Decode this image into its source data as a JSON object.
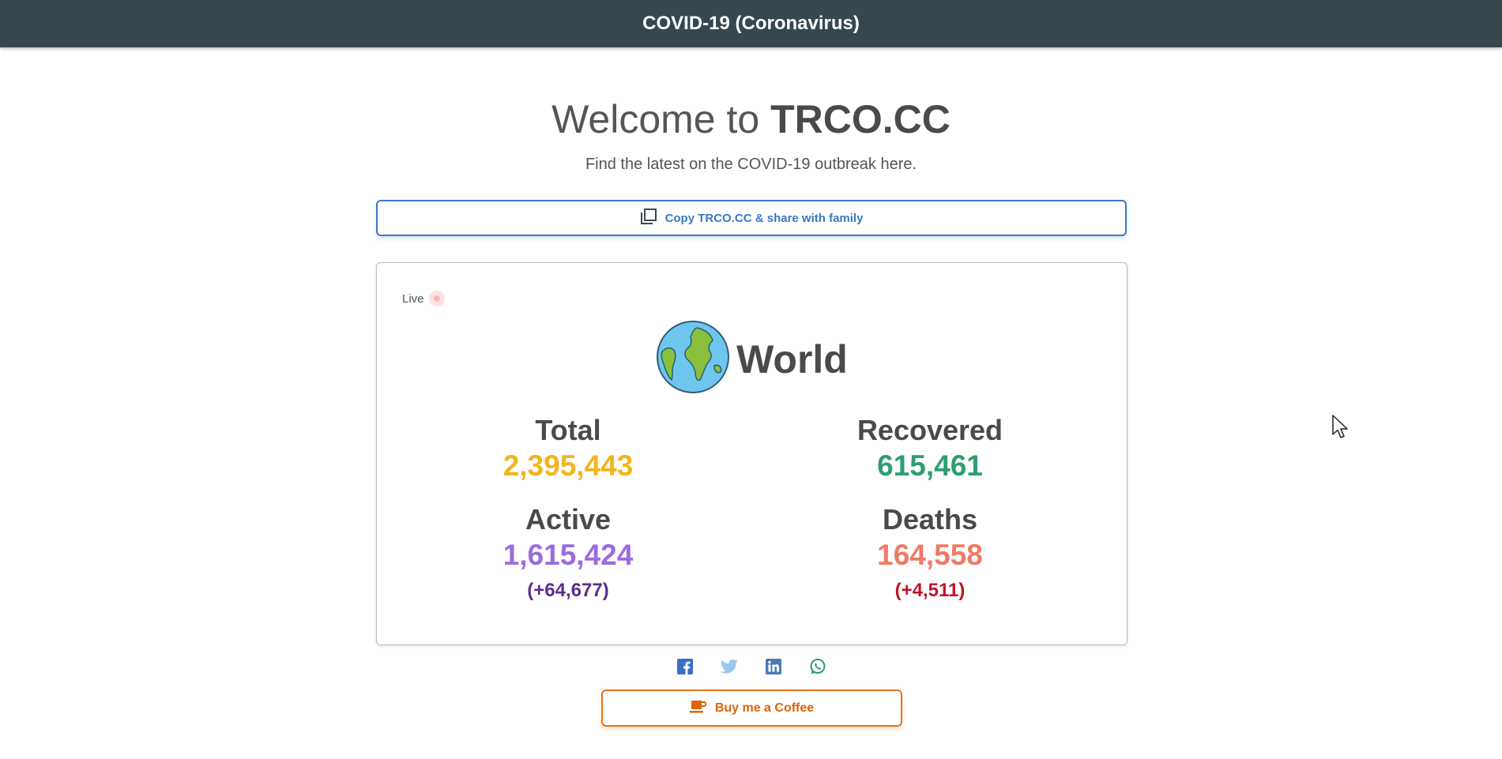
{
  "header": {
    "title": "COVID-19 (Coronavirus)"
  },
  "hero": {
    "welcome_prefix": "Welcome to ",
    "welcome_brand": "TRCO.CC",
    "subtitle": "Find the latest on the COVID-19 outbreak here."
  },
  "copy_button": {
    "label": "Copy TRCO.CC & share with family",
    "icon": "copy-icon"
  },
  "card": {
    "live_label": "Live",
    "region_name": "World",
    "region_icon": "globe-icon",
    "stats": {
      "total": {
        "label": "Total",
        "value": "2,395,443",
        "color": "#f2b51d"
      },
      "recovered": {
        "label": "Recovered",
        "value": "615,461",
        "color": "#2e9e6e"
      },
      "active": {
        "label": "Active",
        "value": "1,615,424",
        "delta": "(+64,677)",
        "color": "#9b6be0",
        "delta_color": "#5b2c8e"
      },
      "deaths": {
        "label": "Deaths",
        "value": "164,558",
        "delta": "(+4,511)",
        "color": "#ee7b66",
        "delta_color": "#c0142a"
      }
    }
  },
  "share": {
    "icons": [
      "facebook-icon",
      "twitter-icon",
      "linkedin-icon",
      "whatsapp-icon"
    ],
    "colors": {
      "facebook": "#3b6fc5",
      "twitter": "#9cc7ef",
      "linkedin": "#4a7bb8",
      "whatsapp": "#2e9e6e"
    }
  },
  "coffee_button": {
    "label": "Buy me a Coffee",
    "icon": "coffee-icon",
    "color": "#e0620c"
  }
}
